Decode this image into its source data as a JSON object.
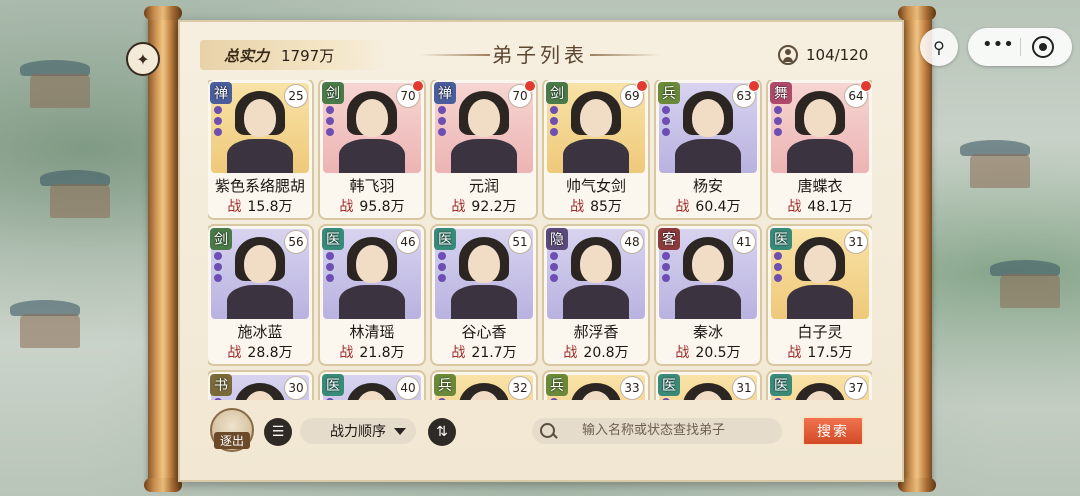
{
  "header": {
    "power_label": "总实力",
    "power_value": "1797万",
    "title": "弟子列表",
    "count": "104/120"
  },
  "disciples": [
    {
      "class": "禅",
      "class_color": "#4a5d9c",
      "level": "25",
      "name": "紫色系络腮胡",
      "power": "15.8万",
      "bg": "gold",
      "alert": false
    },
    {
      "class": "剑",
      "class_color": "#4a7a4a",
      "level": "70",
      "name": "韩飞羽",
      "power": "95.8万",
      "bg": "pink",
      "alert": true
    },
    {
      "class": "禅",
      "class_color": "#4a5d9c",
      "level": "70",
      "name": "元润",
      "power": "92.2万",
      "bg": "pink",
      "alert": true
    },
    {
      "class": "剑",
      "class_color": "#4a7a4a",
      "level": "69",
      "name": "帅气女剑",
      "power": "85万",
      "bg": "gold",
      "alert": true
    },
    {
      "class": "兵",
      "class_color": "#6a8a3a",
      "level": "63",
      "name": "杨安",
      "power": "60.4万",
      "bg": "purple",
      "alert": true
    },
    {
      "class": "舞",
      "class_color": "#b04a6a",
      "level": "64",
      "name": "唐蝶衣",
      "power": "48.1万",
      "bg": "pink",
      "alert": true
    },
    {
      "class": "剑",
      "class_color": "#4a7a4a",
      "level": "56",
      "name": "施冰蓝",
      "power": "28.8万",
      "bg": "purple",
      "alert": false
    },
    {
      "class": "医",
      "class_color": "#3a8a7a",
      "level": "46",
      "name": "林清瑶",
      "power": "21.8万",
      "bg": "purple",
      "alert": false
    },
    {
      "class": "医",
      "class_color": "#3a8a7a",
      "level": "51",
      "name": "谷心香",
      "power": "21.7万",
      "bg": "purple",
      "alert": false
    },
    {
      "class": "隐",
      "class_color": "#5a4a7a",
      "level": "48",
      "name": "郝浮香",
      "power": "20.8万",
      "bg": "purple",
      "alert": false
    },
    {
      "class": "客",
      "class_color": "#8a3a3a",
      "level": "41",
      "name": "秦冰",
      "power": "20.5万",
      "bg": "purple",
      "alert": false
    },
    {
      "class": "医",
      "class_color": "#3a8a7a",
      "level": "31",
      "name": "白子灵",
      "power": "17.5万",
      "bg": "gold",
      "alert": false
    },
    {
      "class": "书",
      "class_color": "#7a6a3a",
      "level": "30",
      "name": "",
      "power": "",
      "bg": "purple",
      "alert": false
    },
    {
      "class": "医",
      "class_color": "#3a8a7a",
      "level": "40",
      "name": "",
      "power": "",
      "bg": "purple",
      "alert": false
    },
    {
      "class": "兵",
      "class_color": "#6a8a3a",
      "level": "32",
      "name": "",
      "power": "",
      "bg": "gold",
      "alert": false
    },
    {
      "class": "兵",
      "class_color": "#6a8a3a",
      "level": "33",
      "name": "",
      "power": "",
      "bg": "gold",
      "alert": false
    },
    {
      "class": "医",
      "class_color": "#3a8a7a",
      "level": "31",
      "name": "",
      "power": "",
      "bg": "gold",
      "alert": false
    },
    {
      "class": "医",
      "class_color": "#3a8a7a",
      "level": "37",
      "name": "",
      "power": "",
      "bg": "gold",
      "alert": false
    }
  ],
  "power_prefix": "战",
  "toolbar": {
    "exit_label": "逐出",
    "sort_label": "战力顺序",
    "search_placeholder": "输入名称或状态查找弟子",
    "search_button": "搜索"
  }
}
